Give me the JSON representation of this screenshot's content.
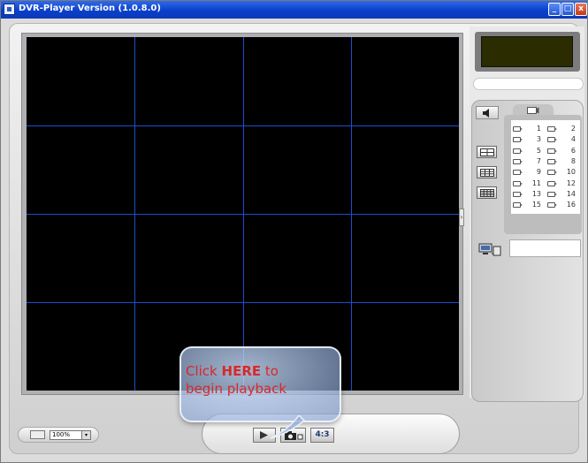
{
  "window": {
    "title": "DVR-Player Version (1.0.8.0)",
    "buttons": {
      "minimize": "_",
      "maximize": "□",
      "close": "x"
    }
  },
  "viewer": {
    "rows": 4,
    "cols": 4,
    "grid_color": "#1a4fd0",
    "background": "#000000"
  },
  "callout": {
    "prefix": "Click ",
    "emphasis": "HERE",
    "suffix": " to",
    "line2": "begin playback",
    "text_color": "#d8282a"
  },
  "cameras": [
    {
      "label": "1"
    },
    {
      "label": "2"
    },
    {
      "label": "3"
    },
    {
      "label": "4"
    },
    {
      "label": "5"
    },
    {
      "label": "6"
    },
    {
      "label": "7"
    },
    {
      "label": "8"
    },
    {
      "label": "9"
    },
    {
      "label": "10"
    },
    {
      "label": "11"
    },
    {
      "label": "12"
    },
    {
      "label": "13"
    },
    {
      "label": "14"
    },
    {
      "label": "15"
    },
    {
      "label": "16"
    }
  ],
  "zoom": {
    "value": "100%",
    "arrow": "▾"
  },
  "controls": {
    "aspect_label": "4:3",
    "play_icon": "play-icon",
    "snapshot_icon": "camera-icon"
  },
  "side_handle": "›",
  "icons": {
    "audio": "speaker-icon",
    "camera_tab": "camera-icon",
    "layout_1": "quad-layout-icon",
    "layout_2": "nine-layout-icon",
    "layout_3": "sixteen-layout-icon",
    "network": "computer-network-icon",
    "zoom": "zoom-icon"
  }
}
